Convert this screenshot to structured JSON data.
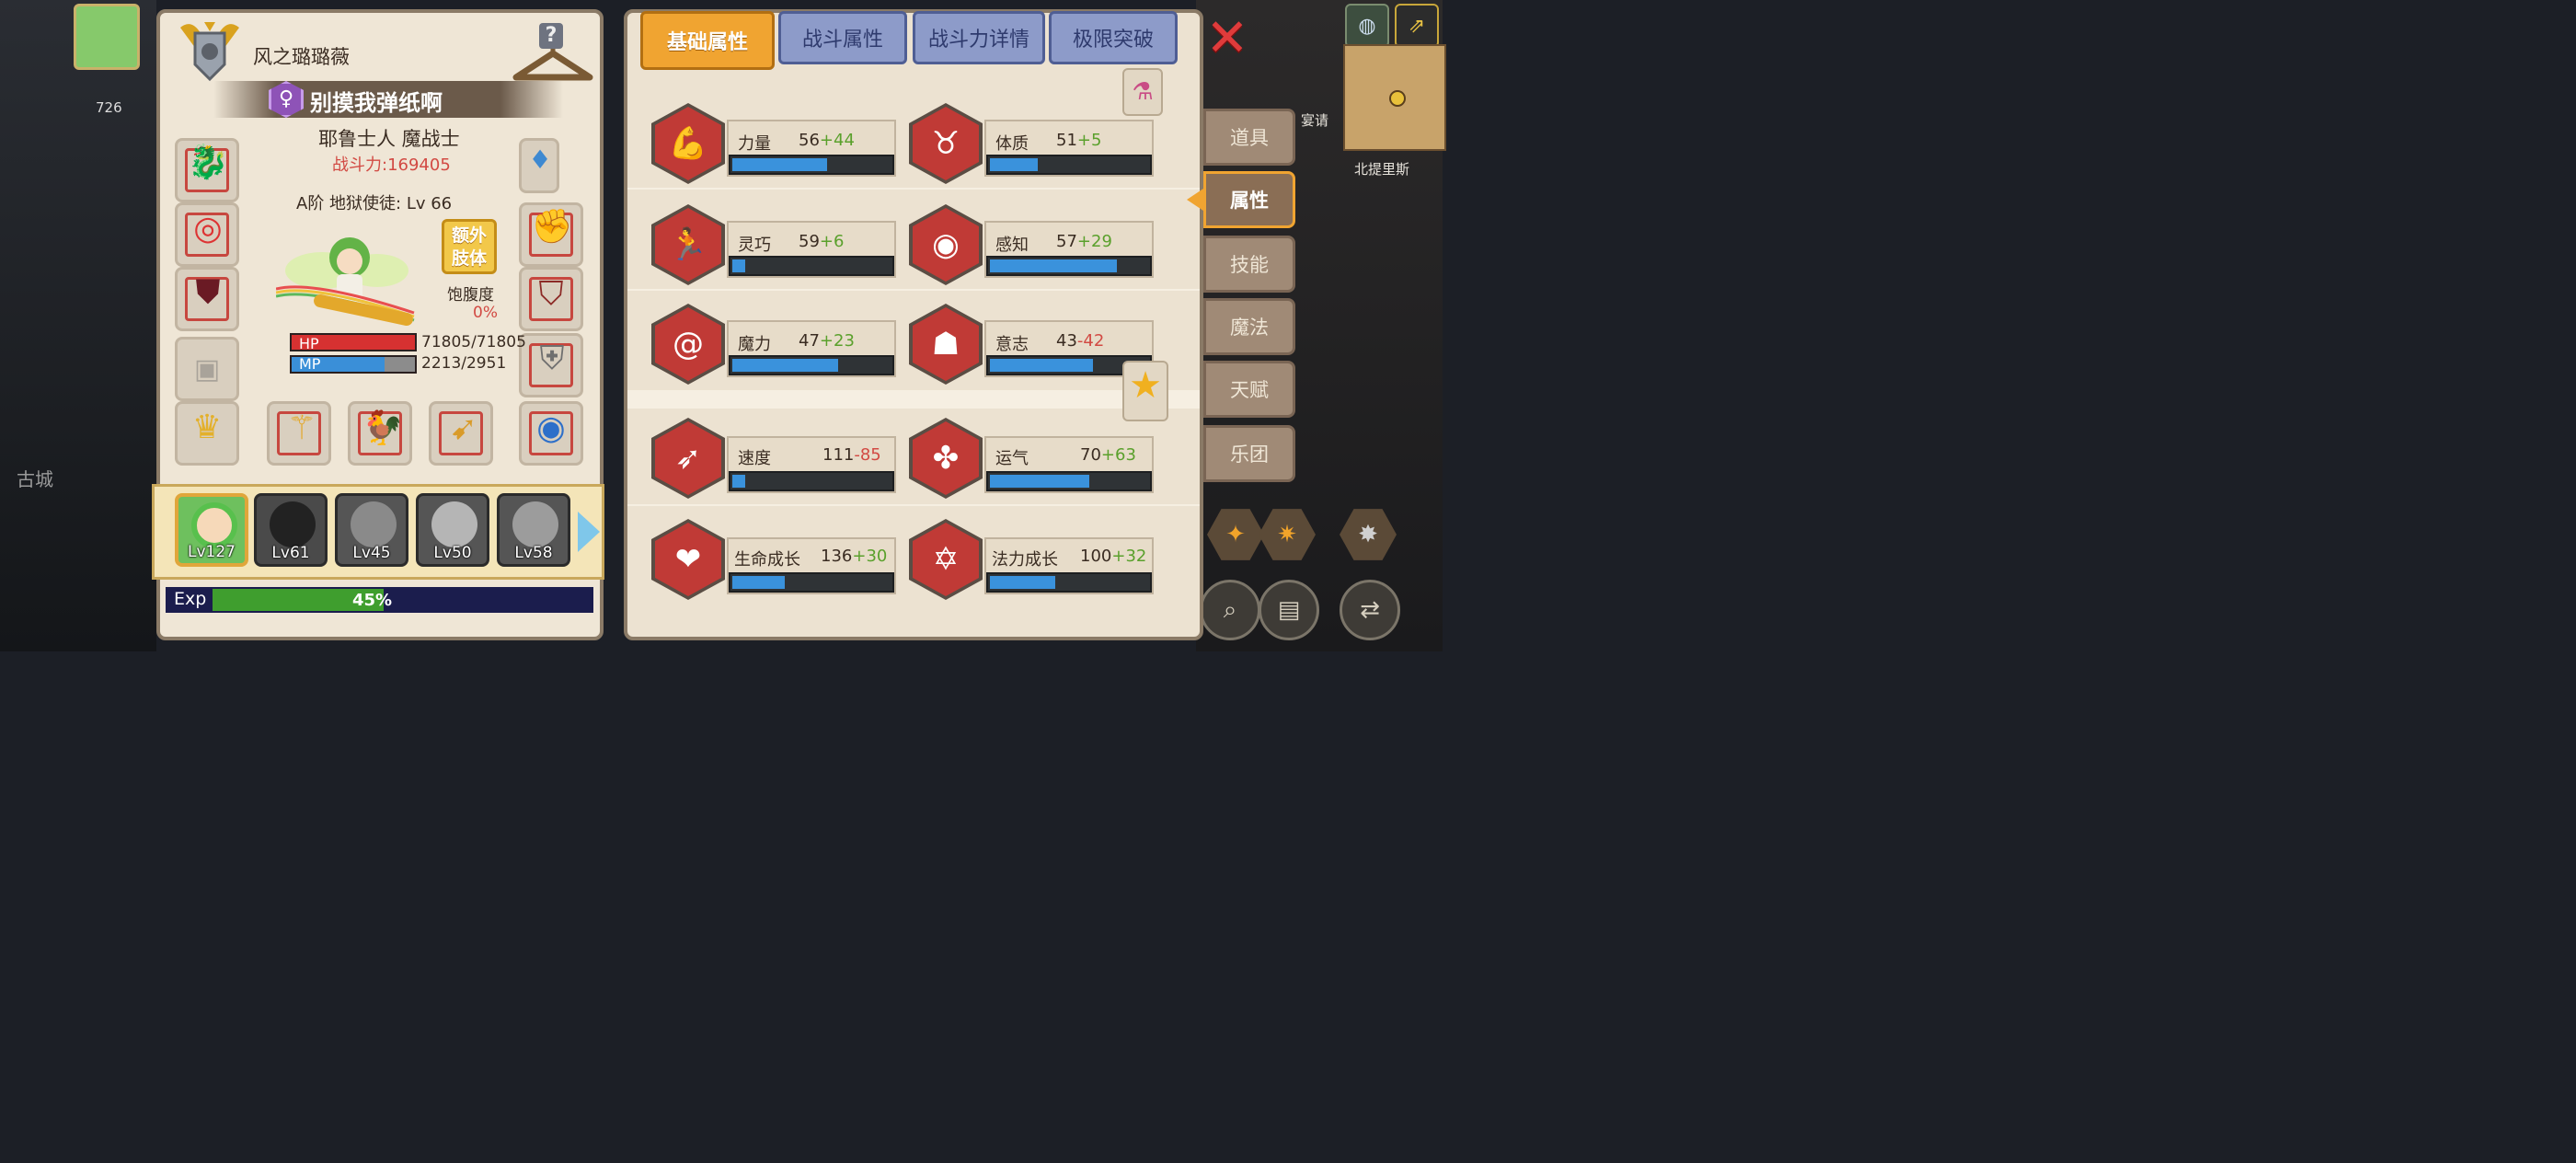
{
  "character": {
    "name": "风之璐璐薇",
    "title": "别摸我弹纸啊",
    "race_class": "耶鲁士人 魔战士",
    "battle_power": "战斗力:169405",
    "rank": "A阶 地狱使徒: Lv 66",
    "extra_limb_line1": "额外",
    "extra_limb_line2": "肢体",
    "satiety_label": "饱腹度",
    "satiety_value": "0%",
    "hp_label": "HP",
    "hp_value": "71805/71805",
    "hp_fraction": 1.0,
    "mp_label": "MP",
    "mp_value": "2213/2951",
    "mp_fraction": 0.75
  },
  "party": {
    "members": [
      {
        "level": "Lv127"
      },
      {
        "level": "Lv61"
      },
      {
        "level": "Lv45"
      },
      {
        "level": "Lv50"
      },
      {
        "level": "Lv58"
      }
    ]
  },
  "exp": {
    "label": "Exp",
    "percent_text": "45%",
    "fraction": 0.45
  },
  "tabs": [
    {
      "label": "基础属性",
      "active": true
    },
    {
      "label": "战斗属性",
      "active": false
    },
    {
      "label": "战斗力详情",
      "active": false
    },
    {
      "label": "极限突破",
      "active": false
    }
  ],
  "stats": [
    {
      "name": "力量",
      "base": "56",
      "bonus": "+44",
      "bonus_type": "pos",
      "fill": 0.6,
      "icon": "arm-icon"
    },
    {
      "name": "体质",
      "base": "51",
      "bonus": "+5",
      "bonus_type": "pos",
      "fill": 0.3,
      "icon": "muscle-icon"
    },
    {
      "name": "灵巧",
      "base": "59",
      "bonus": "+6",
      "bonus_type": "pos",
      "fill": 0.08,
      "icon": "runner-icon"
    },
    {
      "name": "感知",
      "base": "57",
      "bonus": "+29",
      "bonus_type": "pos",
      "fill": 0.8,
      "icon": "eye-icon"
    },
    {
      "name": "魔力",
      "base": "47",
      "bonus": "+23",
      "bonus_type": "pos",
      "fill": 0.67,
      "icon": "swirl-icon"
    },
    {
      "name": "意志",
      "base": "43",
      "bonus": "-42",
      "bonus_type": "neg",
      "fill": 0.65,
      "icon": "head-icon"
    },
    {
      "name": "速度",
      "base": "111",
      "bonus": "-85",
      "bonus_type": "neg",
      "fill": 0.08,
      "icon": "wing-icon"
    },
    {
      "name": "运气",
      "base": "70",
      "bonus": "+63",
      "bonus_type": "pos",
      "fill": 0.63,
      "icon": "clover-icon"
    },
    {
      "name": "生命成长",
      "base": "136",
      "bonus": "+30",
      "bonus_type": "pos",
      "fill": 0.33,
      "icon": "heart-icon"
    },
    {
      "name": "法力成长",
      "base": "100",
      "bonus": "+32",
      "bonus_type": "pos",
      "fill": 0.41,
      "icon": "rune-icon"
    }
  ],
  "side_tabs": [
    {
      "label": "道具",
      "active": false
    },
    {
      "label": "属性",
      "active": true
    },
    {
      "label": "技能",
      "active": false
    },
    {
      "label": "魔法",
      "active": false
    },
    {
      "label": "天赋",
      "active": false
    },
    {
      "label": "乐团",
      "active": false
    }
  ],
  "background": {
    "location": "北提里斯",
    "count": "726",
    "gold_partial": "宴请",
    "left_town": "古城"
  },
  "colors": {
    "accent": "#f0a431",
    "hp": "#d63131",
    "mp": "#3a8fd8",
    "stat_fill": "#3a92dc",
    "bonus_pos": "#5aa02c",
    "bonus_neg": "#d24a43"
  }
}
